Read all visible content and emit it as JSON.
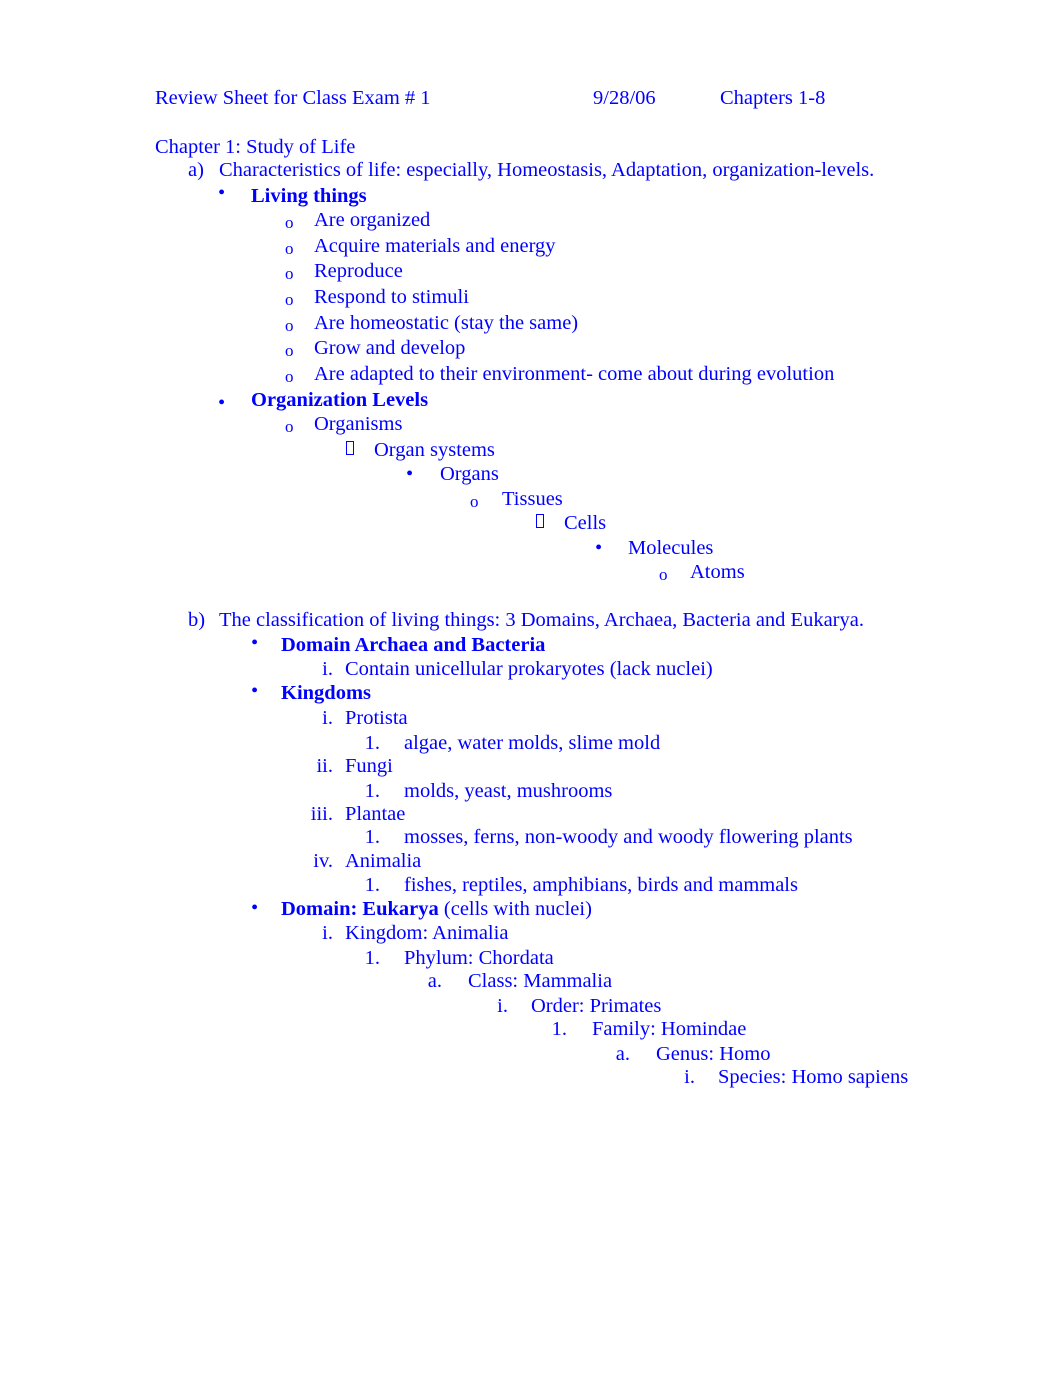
{
  "document": {
    "text_color": "#0000ff",
    "background_color": "#ffffff",
    "header": {
      "title": "Review Sheet for Class Exam # 1",
      "date": "9/28/06",
      "chapters": "Chapters 1-8"
    },
    "chapter_heading": "Chapter 1: Study of Life",
    "sections": [
      {
        "marker": "a)",
        "title": "Characteristics of life:  especially, Homeostasis, Adaptation, organization-levels."
      },
      {
        "marker": "b)",
        "title": "The classification of living things: 3 Domains, Archaea, Bacteria and Eukarya."
      }
    ],
    "living_things": {
      "heading": "Living things",
      "items": [
        "Are organized",
        "Acquire materials and energy",
        "Reproduce",
        "Respond to stimuli",
        "Are homeostatic (stay the same)",
        "Grow and develop",
        "Are adapted to their environment- come about during evolution"
      ]
    },
    "organization_levels": {
      "heading": "Organization Levels",
      "cascade": [
        {
          "label": "Organisms",
          "bullet": "circle-o-bullet"
        },
        {
          "label": "Organ systems",
          "bullet": "square-box-bullet"
        },
        {
          "label": "Organs",
          "bullet": "round-dot-bullet"
        },
        {
          "label": "Tissues",
          "bullet": "circle-o-bullet"
        },
        {
          "label": "Cells",
          "bullet": "square-box-bullet"
        },
        {
          "label": "Molecules",
          "bullet": "round-dot-bullet"
        },
        {
          "label": "Atoms",
          "bullet": "circle-o-bullet"
        }
      ]
    },
    "domain_archaea": {
      "heading": "Domain Archaea and Bacteria",
      "items": [
        {
          "marker": "i.",
          "text": "Contain unicellular prokaryotes (lack nuclei)"
        }
      ]
    },
    "kingdoms": {
      "heading": "Kingdoms",
      "items": [
        {
          "marker": "i.",
          "name": "Protista",
          "sub_marker": "1.",
          "examples": "algae, water molds, slime mold"
        },
        {
          "marker": "ii.",
          "name": "Fungi",
          "sub_marker": "1.",
          "examples": "molds, yeast, mushrooms"
        },
        {
          "marker": "iii.",
          "name": "Plantae",
          "sub_marker": "1.",
          "examples": "mosses, ferns, non-woody and woody flowering plants"
        },
        {
          "marker": "iv.",
          "name": "Animalia",
          "sub_marker": "1.",
          "examples": "fishes, reptiles, amphibians, birds and mammals"
        }
      ]
    },
    "eukarya": {
      "heading_bold": "Domain: Eukarya",
      "heading_note": " (cells with nuclei)",
      "taxonomy": [
        {
          "marker": "i.",
          "text": "Kingdom: Animalia"
        },
        {
          "marker": "1.",
          "text": "Phylum: Chordata"
        },
        {
          "marker": "a.",
          "text": "Class: Mammalia"
        },
        {
          "marker": "i.",
          "text": "Order: Primates"
        },
        {
          "marker": "1.",
          "text": "Family: Homindae"
        },
        {
          "marker": "a.",
          "text": "Genus: Homo"
        },
        {
          "marker": "i.",
          "text": "Species: Homo sapiens"
        }
      ]
    }
  }
}
